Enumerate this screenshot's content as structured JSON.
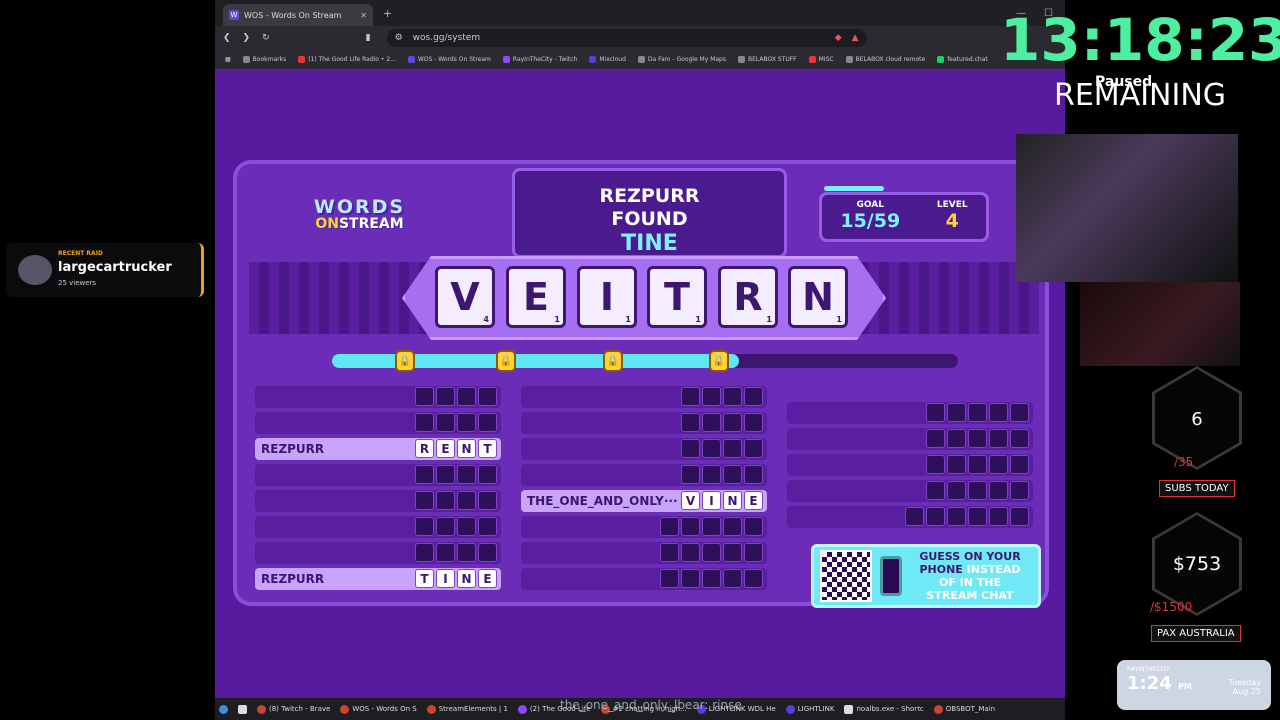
{
  "browser": {
    "tab_title": "WOS - Words On Stream",
    "url": "wos.gg/system",
    "bookmarks": [
      "Bookmarks",
      "(1) The Good Life Radio • 2...",
      "WOS - Words On Stream",
      "RayInTheCity - Twitch",
      "Mixcloud",
      "Da Fam - Google My Maps",
      "BELABOX STUFF",
      "MISC",
      "BELABOX cloud remote",
      "featured.chat"
    ]
  },
  "game": {
    "logo_top": "WORDS",
    "logo_on": "ON",
    "logo_bottom": "STREAM",
    "found_player": "REZPURR",
    "found_label": "FOUND",
    "found_word": "TINE",
    "goal_label": "GOAL",
    "goal_value": "15/59",
    "level_label": "LEVEL",
    "level_value": "4",
    "letters": [
      {
        "ch": "V",
        "pts": "4"
      },
      {
        "ch": "E",
        "pts": "1"
      },
      {
        "ch": "I",
        "pts": "1"
      },
      {
        "ch": "T",
        "pts": "1"
      },
      {
        "ch": "R",
        "pts": "1"
      },
      {
        "ch": "N",
        "pts": "1"
      }
    ],
    "progress_fraction": 0.65,
    "solved": [
      {
        "player": "REZPURR",
        "word": [
          "R",
          "E",
          "N",
          "T"
        ]
      },
      {
        "player": "THE_ONE_AND_ONLY···",
        "word": [
          "V",
          "I",
          "N",
          "E"
        ]
      },
      {
        "player": "REZPURR",
        "word": [
          "T",
          "I",
          "N",
          "E"
        ]
      }
    ],
    "qr_line1": "GUESS ON YOUR",
    "qr_line2a": "PHONE",
    "qr_line2b": "INSTEAD",
    "qr_line3": "OF IN THE",
    "qr_line4": "STREAM CHAT"
  },
  "overlay": {
    "raid_label": "RECENT RAID",
    "raid_name": "largecartrucker",
    "raid_viewers": "25 viewers",
    "timer": "13:18:23",
    "paused": "Paused",
    "remaining": "REMAINING",
    "subs_value": "6",
    "subs_goal": "/35",
    "subs_tag": "SUBS TODAY",
    "money_value": "$753",
    "money_goal": "/$1500",
    "money_tag": "PAX AUSTRALIA",
    "clock_channel": "RAYINTHECITY",
    "clock_time": "1:24",
    "clock_ampm": "PM",
    "clock_day": "Tuesday",
    "clock_date": "Aug 25"
  },
  "taskbar": [
    "(8) Twitch - Brave",
    "WOS - Words On S",
    "StreamElements | 1",
    "(2) The Good Life",
    "#2 chatting in high...",
    "LIGHTLINK WDL He",
    "LIGHTLINK",
    "noalbs.exe - Shortc",
    "OBSBOT_Main"
  ],
  "chat_overlay": "the_one_and_only_lbear: rinse"
}
